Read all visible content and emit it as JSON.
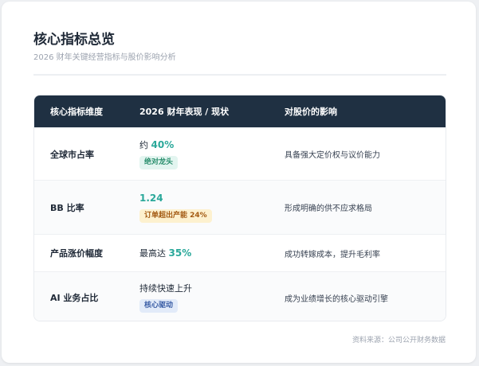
{
  "header": {
    "title": "核心指标总览",
    "subtitle": "2026 财年关键经营指标与股价影响分析"
  },
  "table": {
    "columns": [
      "核心指标维度",
      "2026 财年表现 / 现状",
      "对股价的影响"
    ],
    "rows": [
      {
        "dimension": "全球市占率",
        "value_prefix": "约 ",
        "value_highlight": "40%",
        "badge": "绝对龙头",
        "effect": "具备强大定价权与议价能力"
      },
      {
        "dimension": "BB 比率",
        "value_prefix": "",
        "value_highlight": "1.24",
        "badge": "订单超出产能 24%",
        "effect": "形成明确的供不应求格局"
      },
      {
        "dimension": "产品涨价幅度",
        "value_prefix": "最高达 ",
        "value_highlight": "35%",
        "badge": "",
        "effect": "成功转嫁成本，提升毛利率"
      },
      {
        "dimension": "AI 业务占比",
        "value_prefix": "持续快速上升",
        "value_highlight": "",
        "badge": "核心驱动",
        "effect": "成为业绩增长的核心驱动引擎"
      }
    ]
  },
  "footer": {
    "source": "资料来源：公司公开财务数据"
  },
  "colors": {
    "header_bg": "#1f3042",
    "highlight": "#2aa89a",
    "badge_green": "#e3f5f0",
    "badge_orange": "#fdf1cf",
    "badge_blue": "#e2ebf9"
  }
}
